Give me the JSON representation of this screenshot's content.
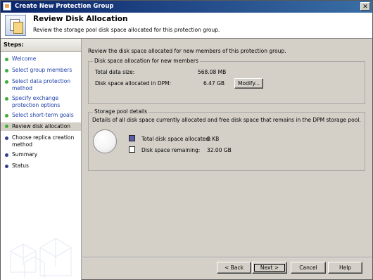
{
  "window": {
    "title": "Create New Protection Group"
  },
  "header": {
    "title": "Review Disk Allocation",
    "subtitle": "Review the storage pool disk space allocated for this protection group."
  },
  "steps": {
    "heading": "Steps:",
    "items": [
      {
        "label": "Welcome",
        "state": "done"
      },
      {
        "label": "Select group members",
        "state": "done"
      },
      {
        "label": "Select data protection method",
        "state": "done"
      },
      {
        "label": "Specify exchange protection options",
        "state": "done"
      },
      {
        "label": "Select short-term goals",
        "state": "done"
      },
      {
        "label": "Review disk allocation",
        "state": "current"
      },
      {
        "label": "Choose replica creation method",
        "state": "todo"
      },
      {
        "label": "Summary",
        "state": "todo"
      },
      {
        "label": "Status",
        "state": "todo"
      }
    ]
  },
  "main": {
    "intro": "Review the disk space allocated for new members of this protection group.",
    "allocation": {
      "title": "Disk space allocation for new members",
      "total_label": "Total data size:",
      "total_value": "568.08 MB",
      "allocated_label": "Disk space allocated in DPM:",
      "allocated_value": "6.47 GB",
      "modify_button": "Modify..."
    },
    "pool": {
      "title": "Storage pool details",
      "description": "Details of all disk space currently allocated and free disk space that remains in the DPM storage pool.",
      "allocated_label": "Total disk space allocated:",
      "allocated_value": "0 KB",
      "remaining_label": "Disk space remaining:",
      "remaining_value": "32.00 GB",
      "allocated_color": "#5b5ea6",
      "remaining_color": "#ffffff"
    }
  },
  "footer": {
    "back": "< Back",
    "next": "Next >",
    "cancel": "Cancel",
    "help": "Help"
  }
}
